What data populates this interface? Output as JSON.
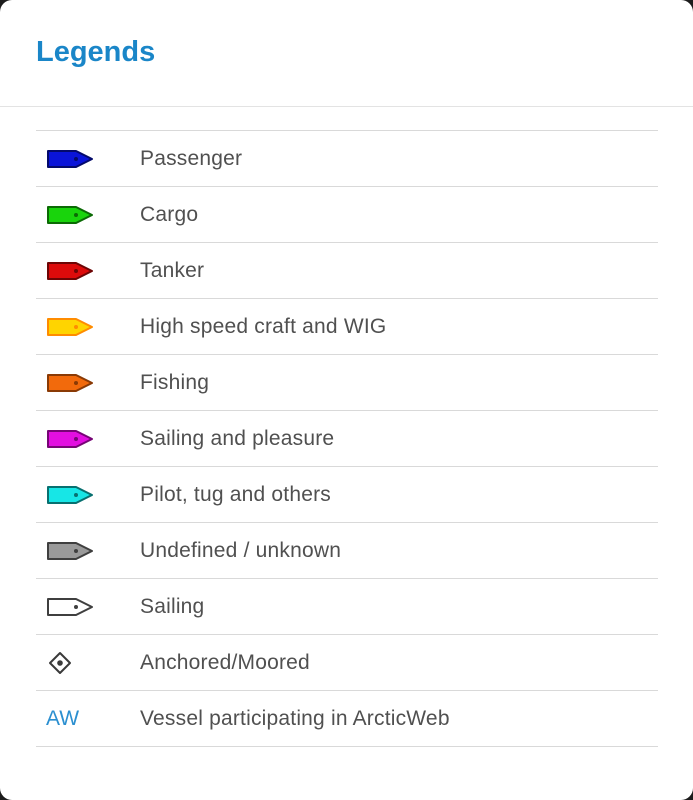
{
  "panel": {
    "title": "Legends"
  },
  "legend": [
    {
      "kind": "vessel",
      "icon": "passenger-vessel-icon",
      "fill": "#0a14d8",
      "stroke": "#040a6a",
      "label": "Passenger"
    },
    {
      "kind": "vessel",
      "icon": "cargo-vessel-icon",
      "fill": "#19d40c",
      "stroke": "#0b6a05",
      "label": "Cargo"
    },
    {
      "kind": "vessel",
      "icon": "tanker-vessel-icon",
      "fill": "#dc0b0b",
      "stroke": "#6d0505",
      "label": "Tanker"
    },
    {
      "kind": "vessel",
      "icon": "high-speed-craft-vessel-icon",
      "fill": "#ffd400",
      "stroke": "#ff8c00",
      "label": "High speed craft and WIG"
    },
    {
      "kind": "vessel",
      "icon": "fishing-vessel-icon",
      "fill": "#f26a0c",
      "stroke": "#8a3a05",
      "label": "Fishing"
    },
    {
      "kind": "vessel",
      "icon": "sailing-pleasure-vessel-icon",
      "fill": "#e20fe0",
      "stroke": "#760575",
      "label": "Sailing and pleasure"
    },
    {
      "kind": "vessel",
      "icon": "pilot-tug-vessel-icon",
      "fill": "#17e6e6",
      "stroke": "#087070",
      "label": "Pilot, tug and others"
    },
    {
      "kind": "vessel",
      "icon": "undefined-vessel-icon",
      "fill": "#9a9a9a",
      "stroke": "#3f3f3f",
      "label": "Undefined / unknown"
    },
    {
      "kind": "vessel",
      "icon": "sailing-vessel-icon",
      "fill": "#ffffff",
      "stroke": "#3f3f3f",
      "label": "Sailing"
    },
    {
      "kind": "anchor",
      "icon": "anchored-moored-icon",
      "fill": "#ffffff",
      "stroke": "#3a3a3a",
      "label": "Anchored/Moored"
    },
    {
      "kind": "text",
      "icon": "arcticweb-icon",
      "symbol_text": "AW",
      "label": "Vessel participating in ArcticWeb"
    }
  ]
}
